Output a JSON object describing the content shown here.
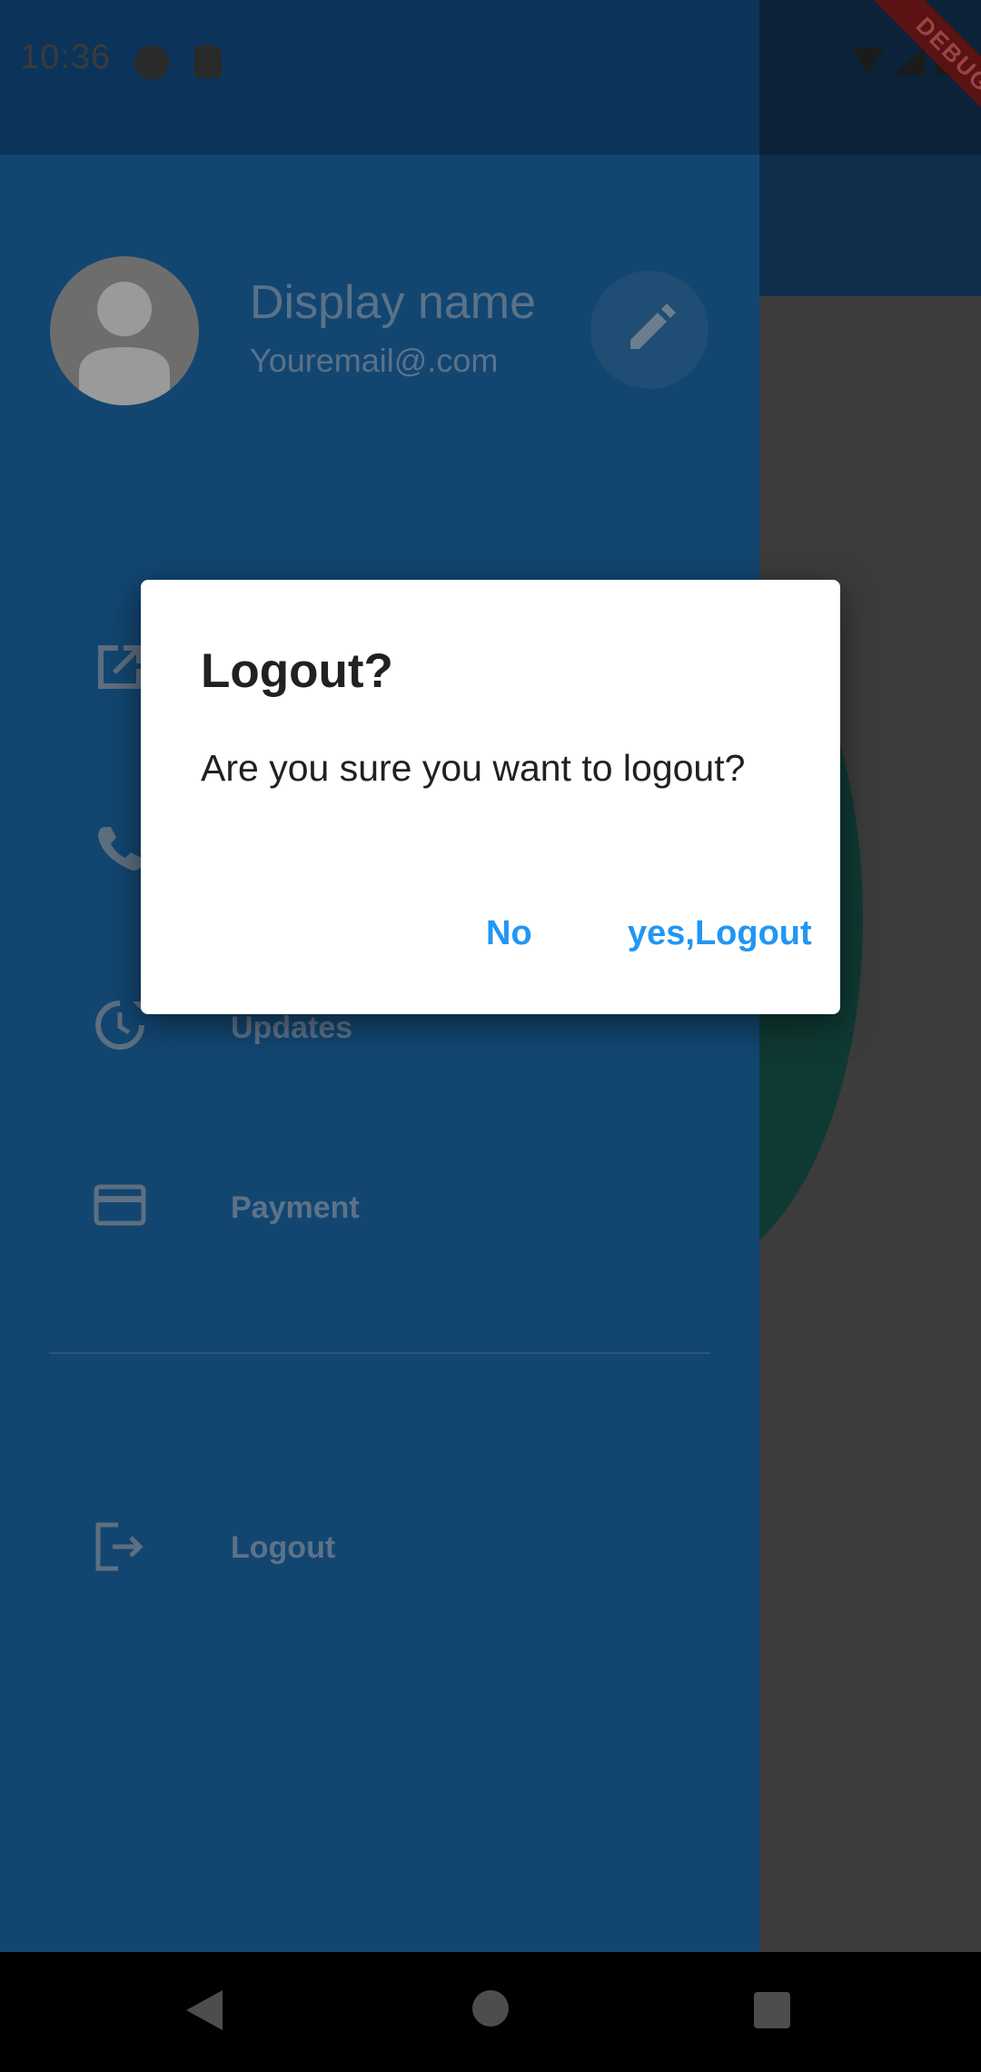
{
  "status_bar": {
    "time": "10:36",
    "debug_banner": "DEBUG"
  },
  "drawer": {
    "header": {
      "display_name": "Display name",
      "email": "Youremail@.com"
    },
    "items": [
      {
        "label": "",
        "icon": "open-in-new-icon"
      },
      {
        "label": "",
        "icon": "phone-icon"
      },
      {
        "label": "Updates",
        "icon": "update-icon"
      },
      {
        "label": "Payment",
        "icon": "credit-card-icon"
      },
      {
        "label": "Logout",
        "icon": "logout-icon"
      }
    ]
  },
  "dialog": {
    "title": "Logout?",
    "message": "Are you sure you want to logout?",
    "buttons": {
      "no": "No",
      "yes": "yes,Logout"
    }
  },
  "colors": {
    "accent": "#2196f3",
    "drawer_bg": "#124671",
    "dialog_bg": "#ffffff"
  }
}
